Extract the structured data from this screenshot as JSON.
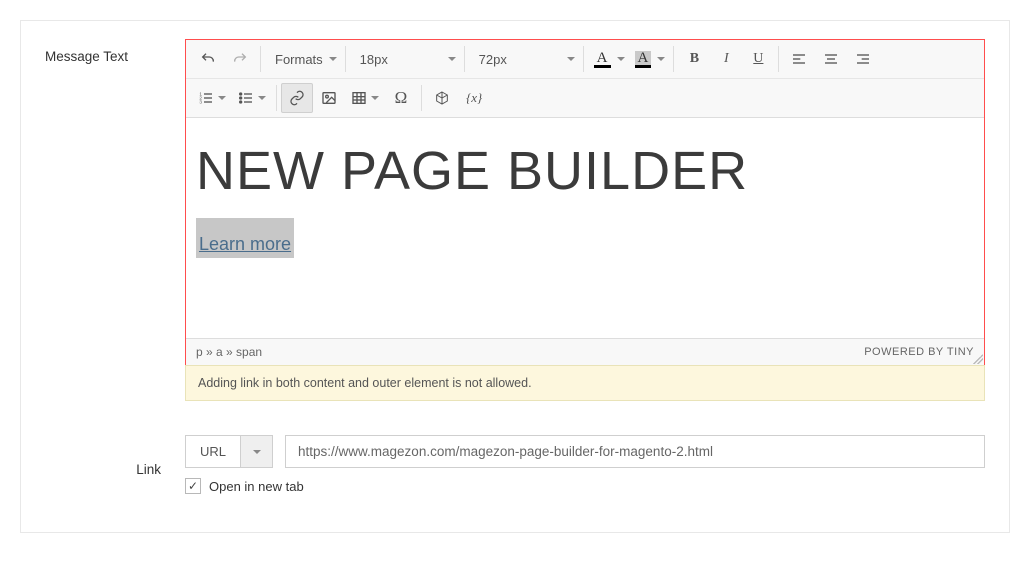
{
  "labels": {
    "message_text": "Message Text",
    "link": "Link"
  },
  "toolbar": {
    "formats_label": "Formats",
    "font_size": "18px",
    "line_height": "72px",
    "variable_label": "{x}"
  },
  "content": {
    "heading": "NEW PAGE BUILDER",
    "link_text": "Learn more"
  },
  "statusbar": {
    "path": "p » a » span",
    "powered": "POWERED BY TINY"
  },
  "warning": "Adding link in both content and outer element is not allowed.",
  "link": {
    "type": "URL",
    "url_value": "https://www.magezon.com/magezon-page-builder-for-magento-2.html",
    "open_new_tab_label": "Open in new tab",
    "open_new_tab_checked": "✓"
  }
}
